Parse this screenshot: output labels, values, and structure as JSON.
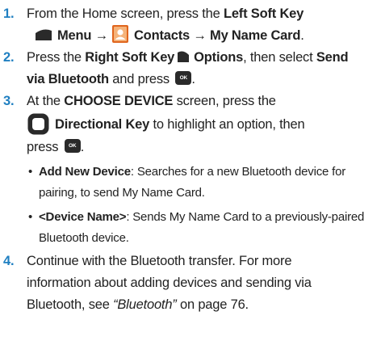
{
  "steps": [
    {
      "num": "1.",
      "line1": {
        "t1": "From the Home screen, press the ",
        "b1": "Left Soft Key"
      },
      "line2": {
        "b1": "Menu →",
        "b2": "Contacts → My Name Card",
        "t1": "."
      }
    },
    {
      "num": "2.",
      "line1": {
        "t1": "Press the ",
        "b1": "Right Soft Key",
        "b2": "Options",
        "t2": ", then select ",
        "b3": "Send"
      },
      "line2": {
        "b1": "via Bluetooth",
        "t1": " and press ",
        "t2": "."
      }
    },
    {
      "num": "3.",
      "line1": {
        "t1": "At the ",
        "b1": "CHOOSE DEVICE",
        "t2": " screen, press the"
      },
      "line2": {
        "b1": "Directional Key",
        "t1": " to highlight an option, then"
      },
      "line3": {
        "t1": "press ",
        "t2": "."
      },
      "bullets": [
        {
          "dot": "•",
          "label": "Add New Device",
          "line1": ": Searches for a new Bluetooth device for",
          "line2": "pairing, to send My Name Card."
        },
        {
          "dot": "•",
          "label": "<Device Name>",
          "line1": ": Sends My Name Card to a previously-paired",
          "line2": "Bluetooth device."
        }
      ]
    },
    {
      "num": "4.",
      "line1": "Continue with the Bluetooth transfer. For more",
      "line2": "information about adding devices and sending via",
      "line3": {
        "t1": "Bluetooth, see ",
        "ref": "“Bluetooth”",
        "t2": " on page 76."
      }
    }
  ],
  "icons": {
    "left_soft_key": "left-soft-key-icon",
    "right_soft_key": "right-soft-key-icon",
    "ok_key": "ok-key-icon",
    "ok_key_text": "OK",
    "contacts": "contacts-icon",
    "directional_key": "directional-key-icon"
  },
  "colors": {
    "step_number": "#1f7fc1",
    "text": "#222222",
    "contacts_icon_bg": "#e0651d",
    "key_fill": "#2a2a2a"
  }
}
